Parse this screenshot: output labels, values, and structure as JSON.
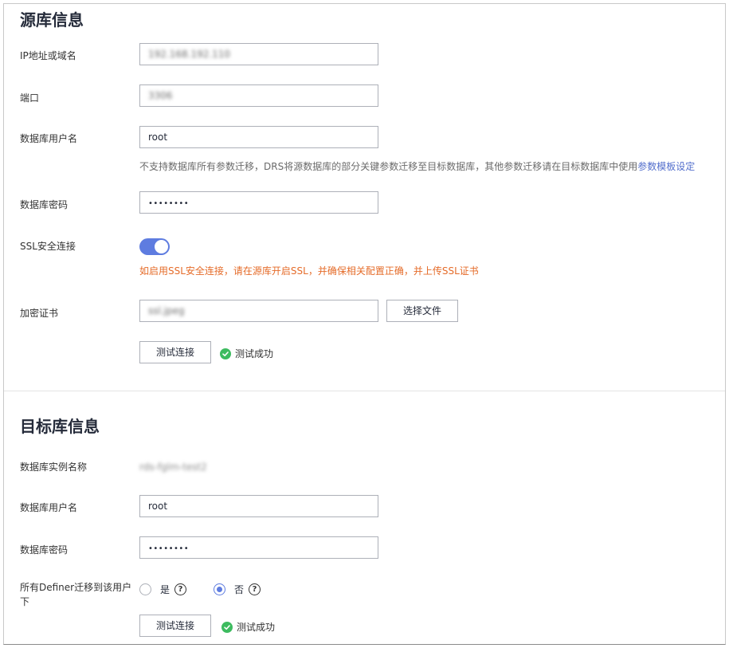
{
  "source": {
    "title": "源库信息",
    "ip": {
      "label": "IP地址或域名",
      "value": "192.168.192.110"
    },
    "port": {
      "label": "端口",
      "value": "3306"
    },
    "username": {
      "label": "数据库用户名",
      "value": "root",
      "hint_text": "不支持数据库所有参数迁移，DRS将源数据库的部分关键参数迁移至目标数据库，其他参数迁移请在目标数据库中使用",
      "hint_link": "参数模板设定"
    },
    "password": {
      "label": "数据库密码",
      "value": "••••••••"
    },
    "ssl": {
      "label": "SSL安全连接",
      "enabled": true,
      "warning": "如启用SSL安全连接，请在源库开启SSL，并确保相关配置正确，并上传SSL证书"
    },
    "cert": {
      "label": "加密证书",
      "value": "ssl.jpeg",
      "select_button": "选择文件"
    },
    "test_button": "测试连接",
    "test_status": "测试成功"
  },
  "target": {
    "title": "目标库信息",
    "instance": {
      "label": "数据库实例名称",
      "value": "rds-fglm-test2"
    },
    "username": {
      "label": "数据库用户名",
      "value": "root"
    },
    "password": {
      "label": "数据库密码",
      "value": "••••••••"
    },
    "definer": {
      "label": "所有Definer迁移到该用户下",
      "options": [
        {
          "label": "是",
          "checked": false
        },
        {
          "label": "否",
          "checked": true
        }
      ]
    },
    "test_button": "测试连接",
    "test_status": "测试成功"
  },
  "colors": {
    "accent": "#5e7ce0",
    "warning": "#e56c2a",
    "success": "#3dbb5f",
    "link": "#526ecc"
  },
  "icons": [
    "check-circle-icon",
    "help-circle-icon"
  ]
}
